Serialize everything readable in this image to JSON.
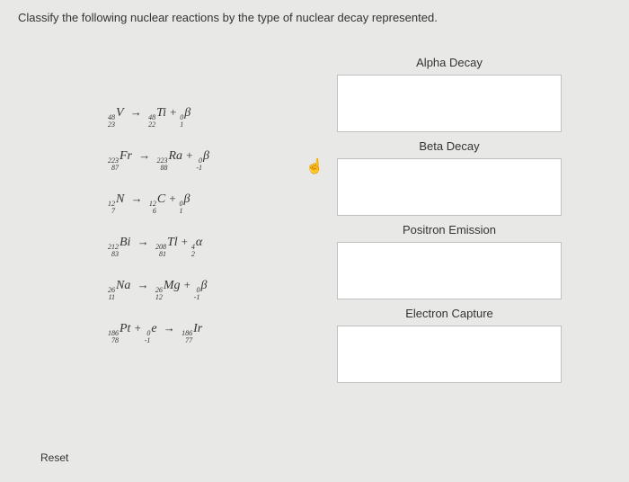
{
  "question": "Classify the following nuclear reactions by the type of nuclear decay represented.",
  "reactions": [
    {
      "r1_mass": "48",
      "r1_z": "23",
      "r1_el": "V",
      "p1_mass": "48",
      "p1_z": "22",
      "p1_el": "Ti",
      "p2_mass": "0",
      "p2_z": "1",
      "p2_el": "β"
    },
    {
      "r1_mass": "223",
      "r1_z": "87",
      "r1_el": "Fr",
      "p1_mass": "223",
      "p1_z": "88",
      "p1_el": "Ra",
      "p2_mass": "0",
      "p2_z": "-1",
      "p2_el": "β"
    },
    {
      "r1_mass": "12",
      "r1_z": "7",
      "r1_el": "N",
      "p1_mass": "12",
      "p1_z": "6",
      "p1_el": "C",
      "p2_mass": "0",
      "p2_z": "1",
      "p2_el": "β"
    },
    {
      "r1_mass": "212",
      "r1_z": "83",
      "r1_el": "Bi",
      "p1_mass": "208",
      "p1_z": "81",
      "p1_el": "Tl",
      "p2_mass": "4",
      "p2_z": "2",
      "p2_el": "α"
    },
    {
      "r1_mass": "26",
      "r1_z": "11",
      "r1_el": "Na",
      "p1_mass": "26",
      "p1_z": "12",
      "p1_el": "Mg",
      "p2_mass": "0",
      "p2_z": "-1",
      "p2_el": "β"
    },
    {
      "r1_mass": "186",
      "r1_z": "78",
      "r1_el": "Pt",
      "r2_mass": "0",
      "r2_z": "-1",
      "r2_el": "e",
      "p1_mass": "186",
      "p1_z": "77",
      "p1_el": "Ir",
      "capture": true
    }
  ],
  "categories": [
    {
      "label": "Alpha Decay"
    },
    {
      "label": "Beta Decay"
    },
    {
      "label": "Positron Emission"
    },
    {
      "label": "Electron Capture"
    }
  ],
  "reset_label": "Reset"
}
